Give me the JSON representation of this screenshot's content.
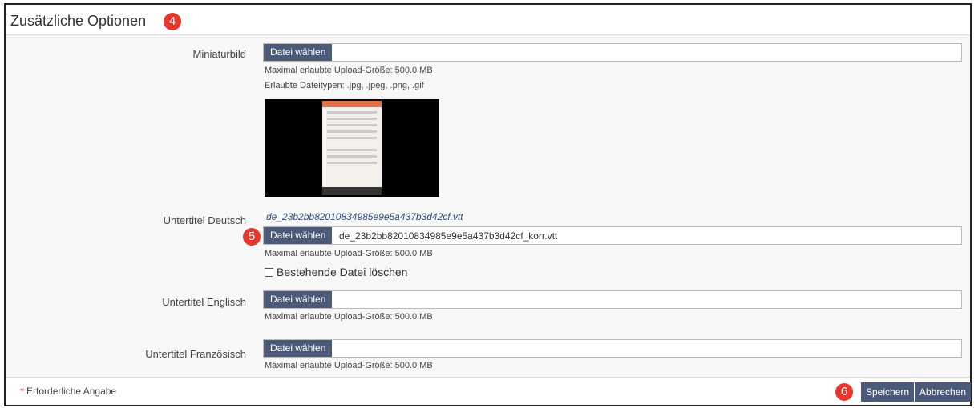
{
  "header": {
    "title": "Zusätzliche Optionen",
    "callout": "4"
  },
  "thumbnail": {
    "label": "Miniaturbild",
    "button": "Datei wählen",
    "max_size": "Maximal erlaubte Upload-Größe: 500.0 MB",
    "allowed_types": "Erlaubte Dateitypen: .jpg, .jpeg, .png, .gif"
  },
  "subtitle_de": {
    "label": "Untertitel Deutsch",
    "existing_file": "de_23b2bb82010834985e9e5a437b3d42cf.vtt",
    "callout": "5",
    "button": "Datei wählen",
    "selected_file": "de_23b2bb82010834985e9e5a437b3d42cf_korr.vtt",
    "max_size": "Maximal erlaubte Upload-Größe: 500.0 MB",
    "delete_label": "Bestehende Datei löschen"
  },
  "subtitle_en": {
    "label": "Untertitel Englisch",
    "button": "Datei wählen",
    "max_size": "Maximal erlaubte Upload-Größe: 500.0 MB"
  },
  "subtitle_fr": {
    "label": "Untertitel Französisch",
    "button": "Datei wählen",
    "max_size": "Maximal erlaubte Upload-Größe: 500.0 MB"
  },
  "footer": {
    "required_star": "*",
    "required_text": "Erforderliche Angabe",
    "callout": "6",
    "save": "Speichern",
    "cancel": "Abbrechen"
  },
  "colors": {
    "button": "#4b5a78",
    "callout": "#e8362d",
    "link": "#2d4a7a"
  }
}
